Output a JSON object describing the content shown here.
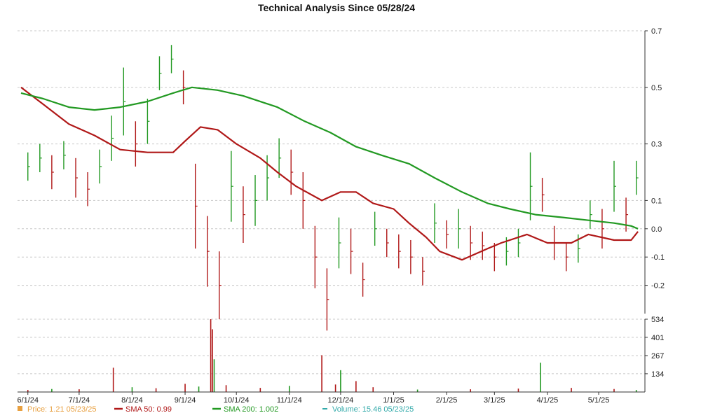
{
  "chart_data": {
    "type": "line",
    "title": "Technical Analysis Since 05/28/24",
    "price_axis": {
      "ylim": [
        -0.3,
        0.7
      ],
      "ticks": [
        "0.7",
        "0.5",
        "0.3",
        "0.1",
        "0.0",
        "-0.1",
        "-0.2"
      ]
    },
    "volume_axis": {
      "ylim": [
        0,
        534
      ],
      "ticks": [
        "534",
        "401",
        "267",
        "134"
      ]
    },
    "x_tick_labels": [
      "6/1/24",
      "7/1/24",
      "8/1/24",
      "9/1/24",
      "10/1/24",
      "11/1/24",
      "12/1/24",
      "1/1/25",
      "2/1/25",
      "3/1/25",
      "4/1/25",
      "5/1/25"
    ],
    "x_ticks_dates": [
      "2024-06-01",
      "2024-07-01",
      "2024-08-01",
      "2024-09-01",
      "2024-10-01",
      "2024-11-01",
      "2024-12-01",
      "2025-01-01",
      "2025-02-01",
      "2025-03-01",
      "2025-04-01",
      "2025-05-01"
    ],
    "series": [
      {
        "name": "SMA 50",
        "color": "#b01818",
        "x": [
          "2024-05-28",
          "2024-06-10",
          "2024-06-25",
          "2024-07-10",
          "2024-07-25",
          "2024-08-10",
          "2024-08-25",
          "2024-09-01",
          "2024-09-10",
          "2024-09-20",
          "2024-10-01",
          "2024-10-15",
          "2024-10-25",
          "2024-11-05",
          "2024-11-20",
          "2024-12-01",
          "2024-12-10",
          "2024-12-20",
          "2025-01-01",
          "2025-01-10",
          "2025-01-20",
          "2025-01-28",
          "2025-02-10",
          "2025-02-25",
          "2025-03-05",
          "2025-03-20",
          "2025-04-01",
          "2025-04-15",
          "2025-04-25",
          "2025-05-10",
          "2025-05-20",
          "2025-05-24"
        ],
        "y": [
          0.5,
          0.44,
          0.37,
          0.33,
          0.28,
          0.27,
          0.27,
          0.31,
          0.36,
          0.35,
          0.3,
          0.25,
          0.2,
          0.15,
          0.1,
          0.13,
          0.13,
          0.09,
          0.07,
          0.02,
          -0.03,
          -0.08,
          -0.11,
          -0.07,
          -0.05,
          -0.02,
          -0.05,
          -0.05,
          -0.02,
          -0.04,
          -0.04,
          -0.01
        ]
      },
      {
        "name": "SMA 200",
        "color": "#229922",
        "x": [
          "2024-05-28",
          "2024-06-10",
          "2024-06-25",
          "2024-07-10",
          "2024-07-25",
          "2024-08-10",
          "2024-08-25",
          "2024-09-05",
          "2024-09-20",
          "2024-10-05",
          "2024-10-25",
          "2024-11-10",
          "2024-11-25",
          "2024-12-10",
          "2024-12-25",
          "2025-01-10",
          "2025-01-25",
          "2025-02-10",
          "2025-02-25",
          "2025-03-10",
          "2025-03-25",
          "2025-04-10",
          "2025-04-25",
          "2025-05-10",
          "2025-05-20",
          "2025-05-24"
        ],
        "y": [
          0.48,
          0.46,
          0.43,
          0.42,
          0.43,
          0.45,
          0.48,
          0.5,
          0.49,
          0.47,
          0.43,
          0.38,
          0.34,
          0.29,
          0.26,
          0.23,
          0.18,
          0.13,
          0.09,
          0.07,
          0.05,
          0.04,
          0.03,
          0.02,
          0.01,
          0.0
        ]
      }
    ],
    "price_bars": {
      "x": [
        "2024-06-01",
        "2024-06-08",
        "2024-06-15",
        "2024-06-22",
        "2024-06-29",
        "2024-07-06",
        "2024-07-13",
        "2024-07-20",
        "2024-07-27",
        "2024-08-03",
        "2024-08-10",
        "2024-08-17",
        "2024-08-24",
        "2024-08-31",
        "2024-09-07",
        "2024-09-14",
        "2024-09-21",
        "2024-09-28",
        "2024-10-05",
        "2024-10-12",
        "2024-10-19",
        "2024-10-26",
        "2024-11-02",
        "2024-11-09",
        "2024-11-16",
        "2024-11-23",
        "2024-11-30",
        "2024-12-07",
        "2024-12-14",
        "2024-12-21",
        "2024-12-28",
        "2025-01-04",
        "2025-01-11",
        "2025-01-18",
        "2025-01-25",
        "2025-02-01",
        "2025-02-08",
        "2025-02-15",
        "2025-02-22",
        "2025-03-01",
        "2025-03-08",
        "2025-03-15",
        "2025-03-22",
        "2025-03-29",
        "2025-04-05",
        "2025-04-12",
        "2025-04-19",
        "2025-04-26",
        "2025-05-03",
        "2025-05-10",
        "2025-05-17",
        "2025-05-23"
      ],
      "close": [
        0.22,
        0.25,
        0.2,
        0.26,
        0.18,
        0.14,
        0.22,
        0.32,
        0.45,
        0.3,
        0.38,
        0.55,
        0.6,
        0.5,
        0.08,
        -0.08,
        -0.2,
        0.15,
        0.05,
        0.1,
        0.18,
        0.25,
        0.2,
        0.1,
        -0.1,
        -0.25,
        -0.05,
        -0.08,
        -0.18,
        0.0,
        -0.05,
        -0.08,
        -0.1,
        -0.15,
        0.02,
        -0.02,
        0.0,
        -0.05,
        -0.06,
        -0.1,
        -0.08,
        -0.05,
        0.15,
        0.12,
        -0.05,
        -0.1,
        -0.07,
        0.05,
        0.0,
        0.15,
        0.05,
        0.18
      ],
      "range": [
        0.1,
        0.1,
        0.12,
        0.1,
        0.14,
        0.12,
        0.12,
        0.16,
        0.24,
        0.16,
        0.16,
        0.12,
        0.1,
        0.12,
        0.3,
        0.25,
        0.24,
        0.25,
        0.2,
        0.18,
        0.16,
        0.14,
        0.16,
        0.2,
        0.22,
        0.22,
        0.18,
        0.16,
        0.12,
        0.12,
        0.1,
        0.12,
        0.12,
        0.1,
        0.14,
        0.1,
        0.14,
        0.12,
        0.1,
        0.1,
        0.1,
        0.1,
        0.24,
        0.12,
        0.12,
        0.1,
        0.1,
        0.1,
        0.14,
        0.18,
        0.12,
        0.12
      ]
    },
    "volume": {
      "x": [
        "2024-06-01",
        "2024-06-15",
        "2024-07-01",
        "2024-07-21",
        "2024-08-01",
        "2024-08-15",
        "2024-09-01",
        "2024-09-09",
        "2024-09-16",
        "2024-09-17",
        "2024-09-18",
        "2024-09-25",
        "2024-10-15",
        "2024-11-01",
        "2024-11-20",
        "2024-11-28",
        "2024-12-01",
        "2024-12-10",
        "2024-12-20",
        "2025-01-15",
        "2025-02-15",
        "2025-03-15",
        "2025-03-28",
        "2025-04-15",
        "2025-05-10",
        "2025-05-23"
      ],
      "values": [
        15,
        22,
        20,
        178,
        35,
        28,
        60,
        40,
        534,
        460,
        240,
        50,
        30,
        45,
        270,
        55,
        160,
        80,
        35,
        18,
        20,
        25,
        215,
        30,
        22,
        15
      ]
    },
    "legend": [
      {
        "label": "Price: 1.21  05/23/25",
        "color": "#e8a040",
        "marker": "square"
      },
      {
        "label": "SMA 50: 0.99",
        "color": "#b01818",
        "marker": "line"
      },
      {
        "label": "SMA 200: 1.002",
        "color": "#229922",
        "marker": "line"
      },
      {
        "label": "Volume: 15.46  05/23/25",
        "color": "#33aaaa",
        "marker": "dash"
      }
    ],
    "legend_placement": "bottom",
    "grid": true,
    "up_color": "#229922",
    "down_color": "#b01818"
  }
}
